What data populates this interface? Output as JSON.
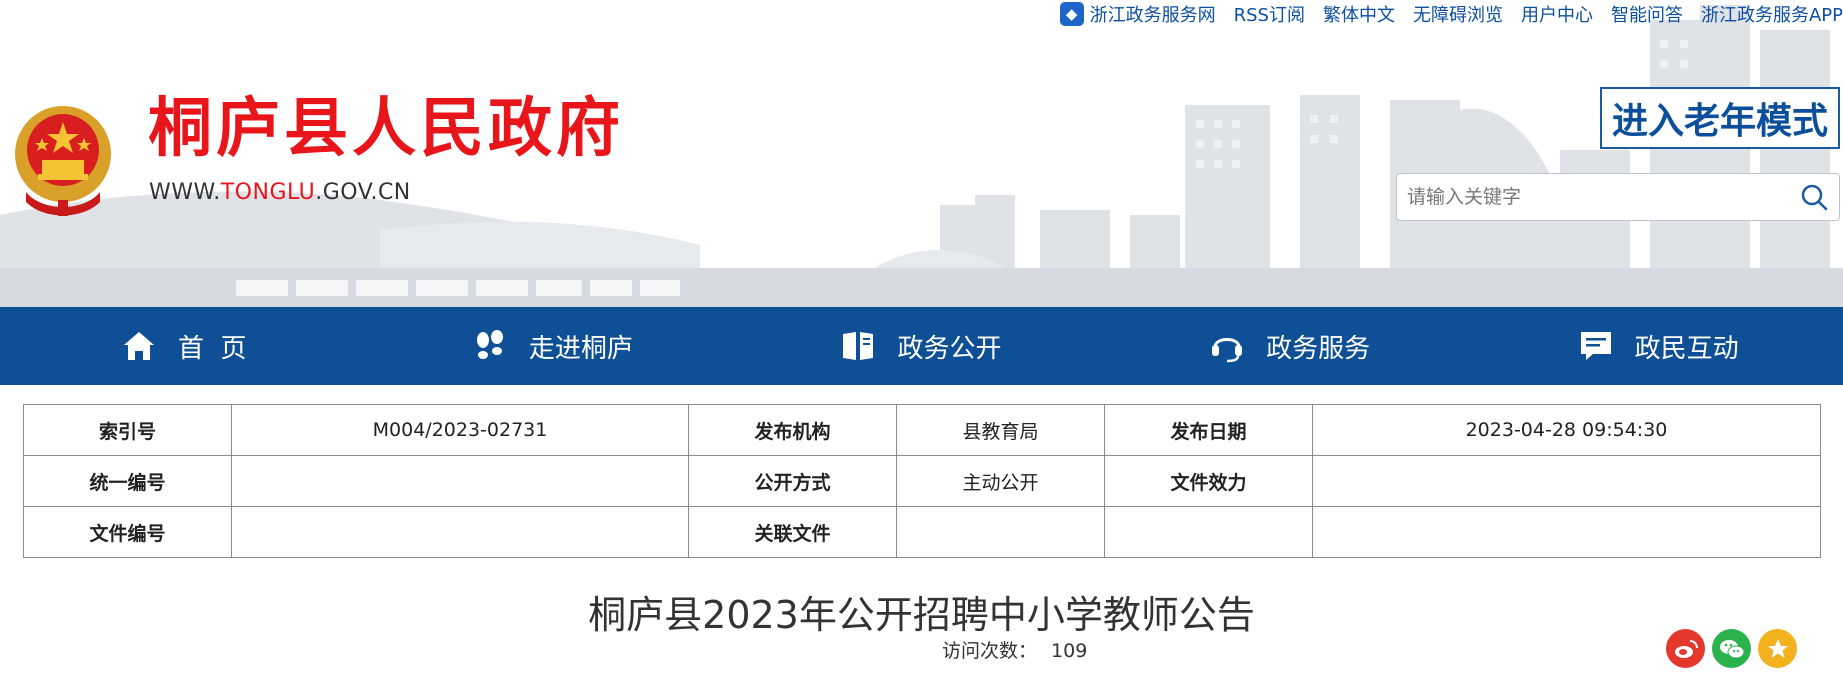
{
  "top_links": {
    "portal": "浙江政务服务网",
    "rss": "RSS订阅",
    "traditional": "繁体中文",
    "accessible": "无障碍浏览",
    "user_center": "用户中心",
    "smart_qa": "智能问答",
    "app": "浙江政务服务APP"
  },
  "header": {
    "site_title": "桐庐县人民政府",
    "url_prefix": "WWW.",
    "url_highlight": "TONGLU",
    "url_suffix": ".GOV.CN",
    "elder_mode": "进入老年模式",
    "search_placeholder": "请输入关键字"
  },
  "nav": {
    "items": [
      {
        "label": "首  页",
        "icon": "home-icon"
      },
      {
        "label": "走进桐庐",
        "icon": "footprints-icon"
      },
      {
        "label": "政务公开",
        "icon": "open-book-icon"
      },
      {
        "label": "政务服务",
        "icon": "headset-icon"
      },
      {
        "label": "政民互动",
        "icon": "message-icon"
      }
    ]
  },
  "info_table": {
    "index_label": "索引号",
    "index_value": "M004/2023-02731",
    "org_label": "发布机构",
    "org_value": "县教育局",
    "date_label": "发布日期",
    "date_value": "2023-04-28 09:54:30",
    "code_label": "统一编号",
    "code_value": "",
    "method_label": "公开方式",
    "method_value": "主动公开",
    "validity_label": "文件效力",
    "validity_value": "",
    "docno_label": "文件编号",
    "docno_value": "",
    "related_label": "关联文件",
    "related_value": ""
  },
  "article": {
    "title": "桐庐县2023年公开招聘中小学教师公告",
    "visits_label": "访问次数：",
    "visits_count": "109"
  },
  "colors": {
    "nav_bg": "#0e4f95",
    "title_red": "#e8161b",
    "weibo": "#e5382d",
    "wechat": "#2bb24c",
    "favorite": "#f3b21d"
  }
}
